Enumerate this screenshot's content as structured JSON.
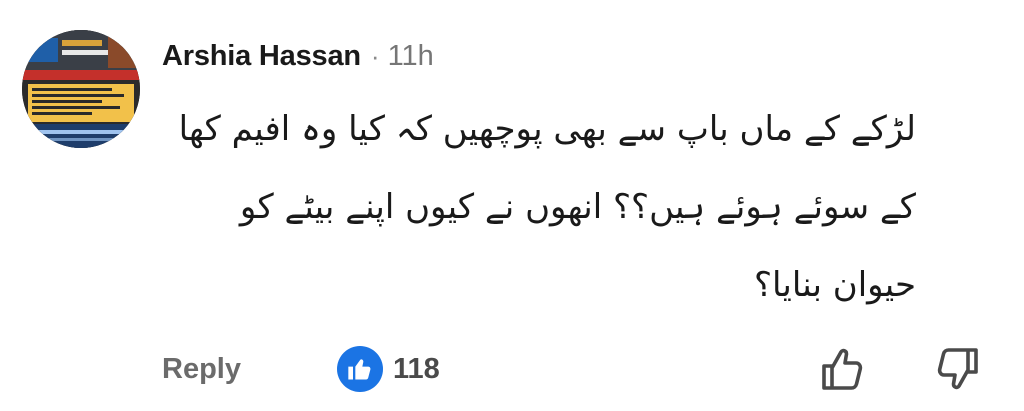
{
  "comment": {
    "author": "Arshia Hassan",
    "separator": "·",
    "time_ago": "11h",
    "text_lines": [
      "لڑکے کے ماں باپ سے بھی پوچھیں کہ کیا وہ افیم کھا",
      "کے سوئے ہوئے ہیں؟؟ انھوں نے کیوں اپنے بیٹے کو",
      "حیوان بنایا؟"
    ]
  },
  "actions": {
    "reply_label": "Reply",
    "like_count": "118"
  },
  "icons": {
    "like_badge": "thumbs-up-icon",
    "upvote": "thumbs-up-outline-icon",
    "downvote": "thumbs-down-outline-icon"
  },
  "colors": {
    "like_badge_bg": "#1b74e4",
    "author_text": "#1a1a1a",
    "meta_text": "#767676",
    "action_text": "#6b6b6b"
  }
}
